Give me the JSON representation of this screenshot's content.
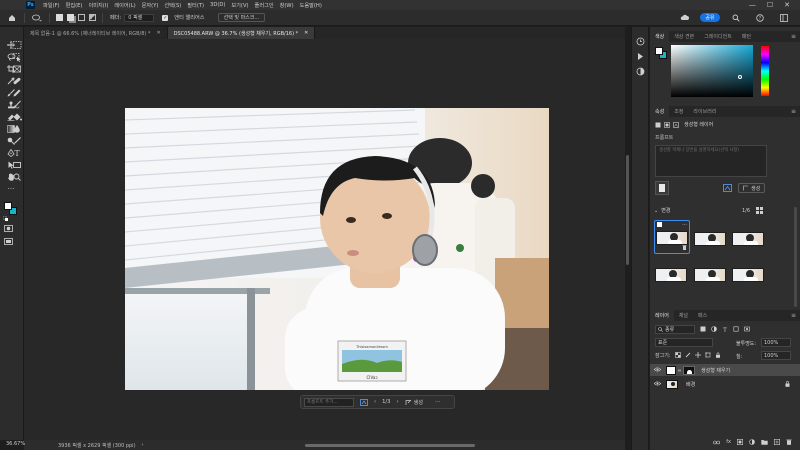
{
  "menubar": {
    "logo": "Ps",
    "items": [
      "파일(F)",
      "편집(E)",
      "이미지(I)",
      "레이어(L)",
      "문자(Y)",
      "선택(S)",
      "필터(T)",
      "3D(D)",
      "보기(V)",
      "플러그인",
      "창(W)",
      "도움말(H)"
    ],
    "controls": [
      "—",
      "☐",
      "✕"
    ]
  },
  "options": {
    "feather_label": "페더:",
    "feather_value": "0 픽셀",
    "antialias_label": "앤티 앨리어스",
    "select_mask_button": "선택 및 마스크...",
    "share_button": "공유"
  },
  "tabs": [
    {
      "label": "제목 없음-1 @ 66.6% (제너레이티브 레이어, RGB/8) *",
      "close": "✕",
      "active": false
    },
    {
      "label": "DSC05488.ARW @ 36.7% (생성형 채우기, RGB/16) *",
      "close": "✕",
      "active": true
    }
  ],
  "canvas": {
    "sticker_header": "Thisisamonilessm",
    "sticker_footer": "CIVaɔ"
  },
  "context_bar": {
    "prompt_placeholder": "프롬프트 추가...",
    "prev": "‹",
    "page": "1/3",
    "next": "›",
    "generate": "생성",
    "more": "···"
  },
  "status": {
    "zoom": "36.67%",
    "doc_size": "3936 픽셀 x 2629 픽셀 (300 ppi)",
    "arrow": "›"
  },
  "color_panel": {
    "tabs": [
      "색상",
      "색상 견본",
      "그레이디언트",
      "패턴"
    ],
    "menu": "≡"
  },
  "properties_panel": {
    "tabs": [
      "속성",
      "조정",
      "라이브러리"
    ],
    "menu": "≡",
    "layer_type": "생성형 레이어",
    "prompt_label": "프롬프트",
    "prompt_placeholder": "생성할 객체나 장면을 설명하세요(선택 사항)",
    "generate_button": "생성",
    "variations_label": "변경",
    "variations_counter": "1/6",
    "more": "···"
  },
  "layers_panel": {
    "tabs": [
      "레이어",
      "채널",
      "패스"
    ],
    "menu": "≡",
    "filter_label": "종류",
    "blend_mode": "표준",
    "opacity_label": "불투명도:",
    "opacity_value": "100%",
    "lock_label": "잠그기:",
    "fill_label": "칠:",
    "fill_value": "100%",
    "layers": [
      {
        "name": "생성형 채우기",
        "visible": true,
        "selected": true
      },
      {
        "name": "배경",
        "visible": true,
        "selected": false
      }
    ],
    "bottom_icons": [
      "링크",
      "fx",
      "마스크",
      "조정",
      "그룹",
      "새 레이어",
      "삭제"
    ]
  },
  "colors": {
    "accent": "#1473e6",
    "foreground": "#ffffff",
    "background": "#17b5c8"
  }
}
